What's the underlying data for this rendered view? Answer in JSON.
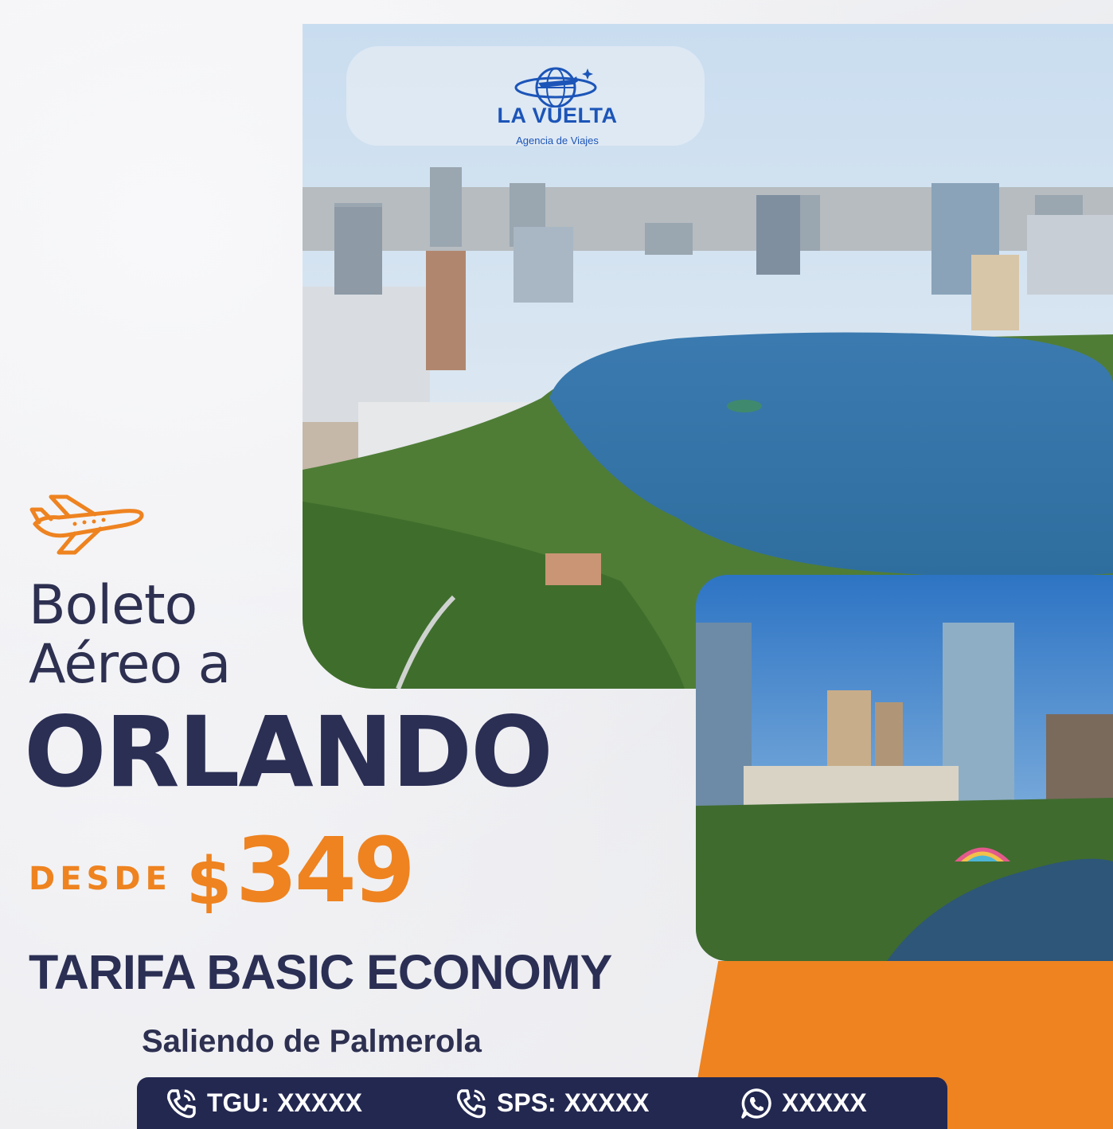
{
  "brand": {
    "name": "LA VUELTA",
    "tagline": "Agencia de Viajes",
    "color": "#1c55b8"
  },
  "headline": {
    "line1": "Boleto",
    "line2": "Aéreo a",
    "city": "ORLANDO"
  },
  "price": {
    "prefix": "DESDE",
    "currency": "$",
    "amount": "349",
    "color": "#ee8320"
  },
  "fare_type": "TARIFA BASIC ECONOMY",
  "departure": "Saliendo de Palmerola",
  "contacts": [
    {
      "icon": "phone-icon",
      "label": "TGU:",
      "value": "XXXXX"
    },
    {
      "icon": "phone-icon",
      "label": "SPS:",
      "value": "XXXXX"
    },
    {
      "icon": "whatsapp-icon",
      "label": "",
      "value": "XXXXX"
    }
  ],
  "colors": {
    "navy": "#2b2f54",
    "orange": "#ee8320",
    "bar": "#232851"
  }
}
